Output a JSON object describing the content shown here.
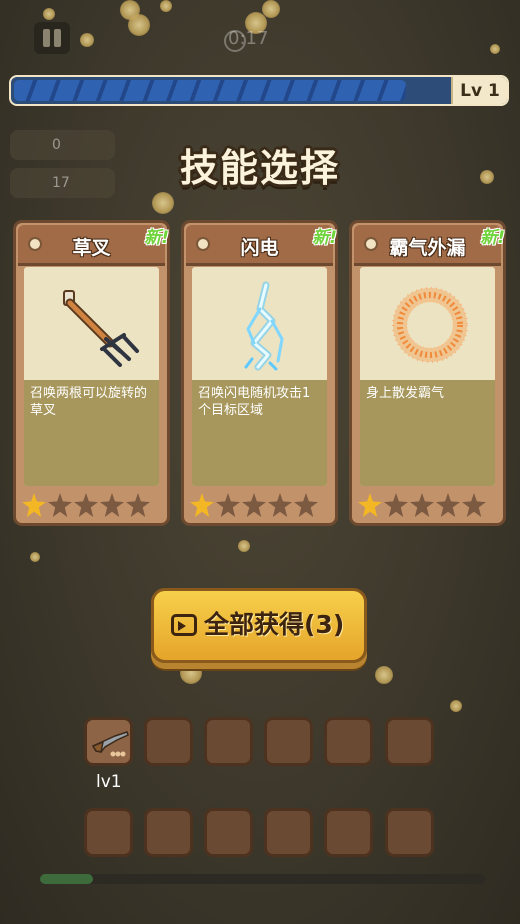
{
  "hud": {
    "timer": "0:17",
    "level_label": "Lv 1",
    "xp_progress": 0.9,
    "stat_top": "0",
    "stat_bottom": "17"
  },
  "title": "技能选择",
  "cards": [
    {
      "name": "草叉",
      "badge": "新!",
      "desc": "召唤两根可以旋转的草叉",
      "stars_filled": 1,
      "stars_total": 5,
      "icon": "pitchfork-icon"
    },
    {
      "name": "闪电",
      "badge": "新!",
      "desc": "召唤闪电随机攻击1个目标区域",
      "stars_filled": 1,
      "stars_total": 5,
      "icon": "lightning-icon"
    },
    {
      "name": "霸气外漏",
      "badge": "新!",
      "desc": "身上散发霸气",
      "stars_filled": 1,
      "stars_total": 5,
      "icon": "aura-ring-icon"
    }
  ],
  "get_all_button": {
    "label": "全部获得(3)",
    "icon": "video-camera-icon"
  },
  "inventory": {
    "weapon": {
      "level_label": "lv1",
      "icon": "shotgun-icon"
    },
    "slots_per_row": 6,
    "rows": 2
  },
  "hp_progress": 0.12,
  "colors": {
    "accent_gold": "#f3b624",
    "new_green": "#6fd33a",
    "xp_blue": "#2f63b2"
  }
}
